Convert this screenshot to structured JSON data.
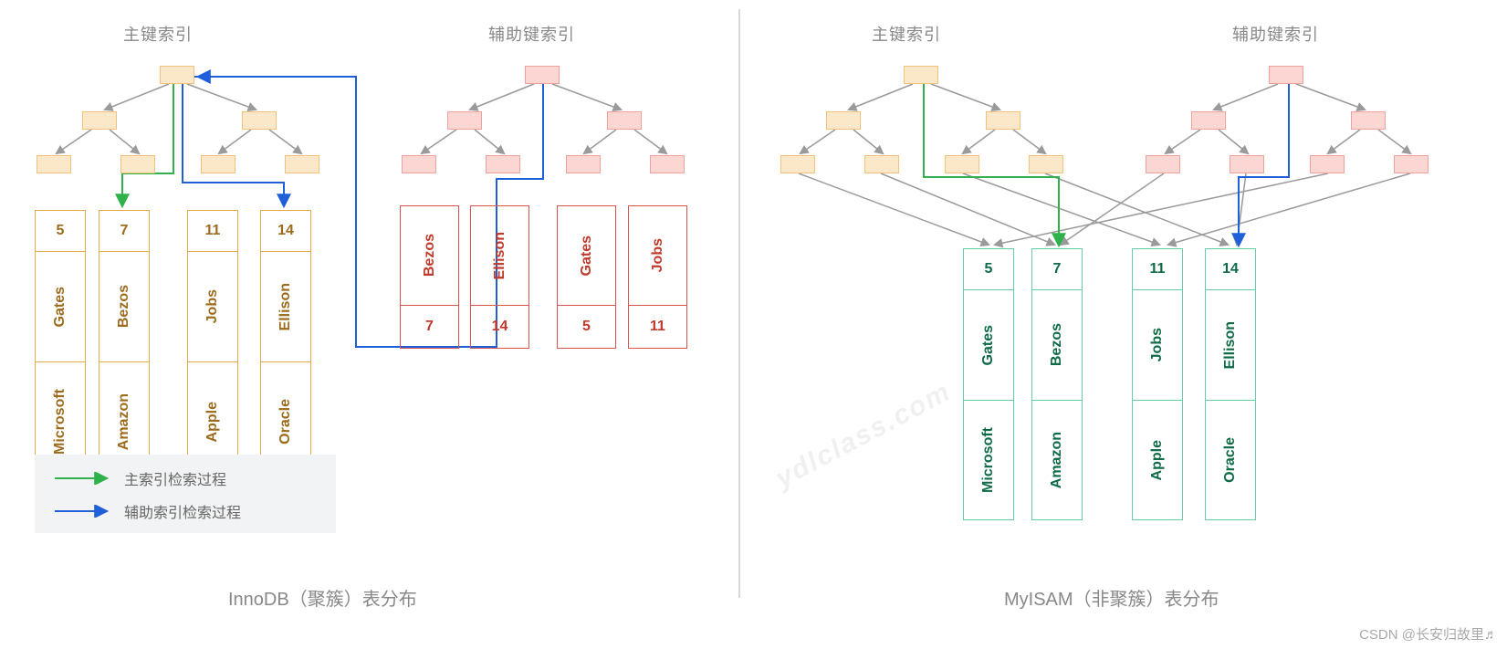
{
  "titles": {
    "left_primary": "主键索引",
    "left_secondary": "辅助键索引",
    "right_primary": "主键索引",
    "right_secondary": "辅助键索引"
  },
  "captions": {
    "left": "InnoDB（聚簇）表分布",
    "right": "MyISAM（非聚簇）表分布"
  },
  "legend": {
    "primary": "主索引检索过程",
    "secondary": "辅助索引检索过程"
  },
  "colors": {
    "arrow_gray": "#9a9a9a",
    "arrow_green": "#2fb24c",
    "arrow_blue": "#1f5fd8",
    "orange_fill": "#fbe8c8",
    "orange_border": "#f0c27b",
    "pink_fill": "#fbd6d2",
    "pink_border": "#efa29c",
    "green_border": "#63d0a3",
    "red_border": "#d9534f"
  },
  "innodb_primary_leaves": [
    {
      "id": "5",
      "name": "Gates",
      "company": "Microsoft"
    },
    {
      "id": "7",
      "name": "Bezos",
      "company": "Amazon"
    },
    {
      "id": "11",
      "name": "Jobs",
      "company": "Apple"
    },
    {
      "id": "14",
      "name": "Ellison",
      "company": "Oracle"
    }
  ],
  "innodb_secondary_leaves": [
    {
      "name": "Bezos",
      "pk": "7"
    },
    {
      "name": "Ellison",
      "pk": "14"
    },
    {
      "name": "Gates",
      "pk": "5"
    },
    {
      "name": "Jobs",
      "pk": "11"
    }
  ],
  "myisam_leaves": [
    {
      "id": "5",
      "name": "Gates",
      "company": "Microsoft"
    },
    {
      "id": "7",
      "name": "Bezos",
      "company": "Amazon"
    },
    {
      "id": "11",
      "name": "Jobs",
      "company": "Apple"
    },
    {
      "id": "14",
      "name": "Ellison",
      "company": "Oracle"
    }
  ],
  "watermarks": {
    "angled": "ydlclass.com",
    "footer": "CSDN @长安归故里♬"
  }
}
